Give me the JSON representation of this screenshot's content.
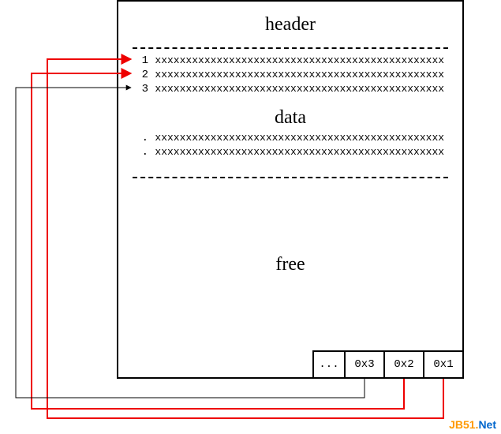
{
  "sections": {
    "header": "header",
    "data": "data",
    "free": "free"
  },
  "rows": [
    {
      "label": "1",
      "content": "xxxxxxxxxxxxxxxxxxxxxxxxxxxxxxxxxxxxxxxxxxxxxxx"
    },
    {
      "label": "2",
      "content": "xxxxxxxxxxxxxxxxxxxxxxxxxxxxxxxxxxxxxxxxxxxxxxx"
    },
    {
      "label": "3",
      "content": "xxxxxxxxxxxxxxxxxxxxxxxxxxxxxxxxxxxxxxxxxxxxxxx"
    },
    {
      "label": ".",
      "content": "xxxxxxxxxxxxxxxxxxxxxxxxxxxxxxxxxxxxxxxxxxxxxxx"
    },
    {
      "label": ".",
      "content": "xxxxxxxxxxxxxxxxxxxxxxxxxxxxxxxxxxxxxxxxxxxxxxx"
    }
  ],
  "slots": [
    "...",
    "0x3",
    "0x2",
    "0x1"
  ],
  "watermark": {
    "part1": "JB51.",
    "part2": "Net"
  },
  "arrows": [
    {
      "from_slot": "0x1",
      "to_row": 1,
      "color": "red"
    },
    {
      "from_slot": "0x2",
      "to_row": 2,
      "color": "red"
    },
    {
      "from_slot": "0x3",
      "to_row": 3,
      "color": "black"
    }
  ],
  "chart_data": {
    "type": "diagram",
    "description": "Block layout with header, data rows (1..N), free space, and a slot directory at bottom pointing to row offsets.",
    "slot_directory": [
      {
        "slot": "0x1",
        "points_to_row": 1
      },
      {
        "slot": "0x2",
        "points_to_row": 2
      },
      {
        "slot": "0x3",
        "points_to_row": 3
      }
    ]
  }
}
